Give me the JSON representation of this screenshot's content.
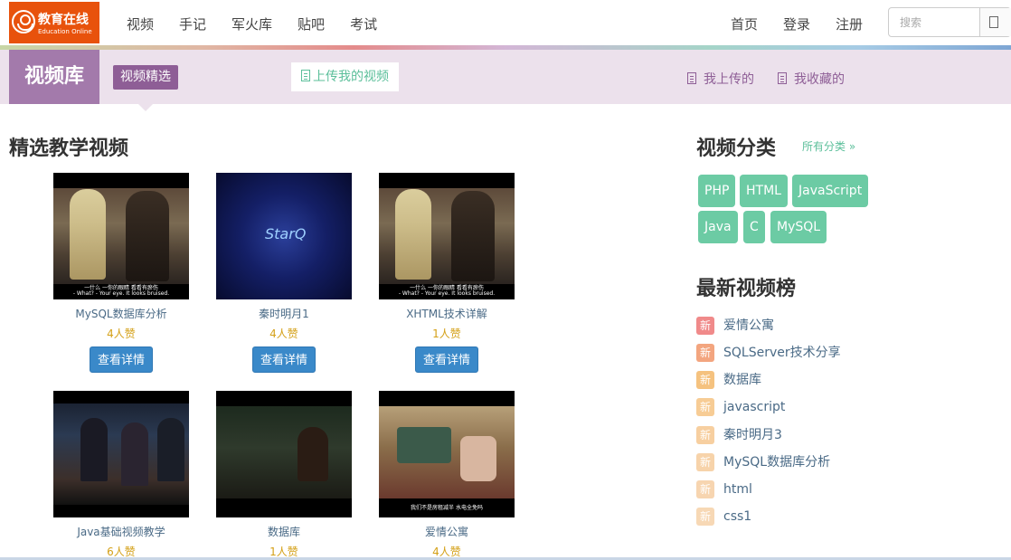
{
  "logo": {
    "name": "教育在线",
    "sub": "Education Online"
  },
  "nav": {
    "left": [
      "视频",
      "手记",
      "军火库",
      "贴吧",
      "考试"
    ],
    "right": [
      "首页",
      "登录",
      "注册"
    ]
  },
  "search": {
    "placeholder": "搜索"
  },
  "subheader": {
    "title": "视频库",
    "chip": "视频精选",
    "upload": "上传我的视频",
    "my_uploads": "我上传的",
    "my_favorites": "我收藏的"
  },
  "featured": {
    "title": "精选教学视频",
    "button_label": "查看详情",
    "videos": [
      {
        "title": "MySQL数据库分析",
        "likes": "4人赞",
        "subtitle": "一什么 一你的眼睛 看看有瘀伤",
        "subtitle2": "- What? - Your eye. It looks bruised."
      },
      {
        "title": "秦时明月1",
        "likes": "4人赞",
        "logo": "StarQ"
      },
      {
        "title": "XHTML技术详解",
        "likes": "1人赞",
        "subtitle": "一什么 一你的眼睛 看看有瘀伤",
        "subtitle2": "- What? - Your eye. It looks bruised."
      },
      {
        "title": "Java基础视频教学",
        "likes": "6人赞"
      },
      {
        "title": "数据库",
        "likes": "1人赞"
      },
      {
        "title": "爱情公寓",
        "likes": "4人赞",
        "subtitle": "我们不是房租减半 水电全免吗"
      }
    ]
  },
  "categories": {
    "title": "视频分类",
    "all_link": "所有分类 »",
    "tags": [
      "PHP",
      "HTML",
      "JavaScript",
      "Java",
      "C",
      "MySQL"
    ]
  },
  "ranking": {
    "title": "最新视频榜",
    "badge": "新",
    "items": [
      "爱情公寓",
      "SQLServer技术分享",
      "数据库",
      "javascript",
      "秦时明月3",
      "MySQL数据库分析",
      "html",
      "css1"
    ]
  },
  "colors": {
    "logo_bg": "#e8520c",
    "sub_title_bg": "#a37aab",
    "chip_bg": "#8e5e96",
    "accent_green": "#5bbf9a",
    "tag_bg": "#6ccba4",
    "button_blue": "#3a89c9",
    "likes_gold": "#d4a017",
    "rank_badges": [
      "#f08a8a",
      "#f3a57f",
      "#f5c27f",
      "#f7cc95",
      "#f7cfa0",
      "#f7d3aa",
      "#f7d5b0",
      "#f7d8b5"
    ]
  }
}
